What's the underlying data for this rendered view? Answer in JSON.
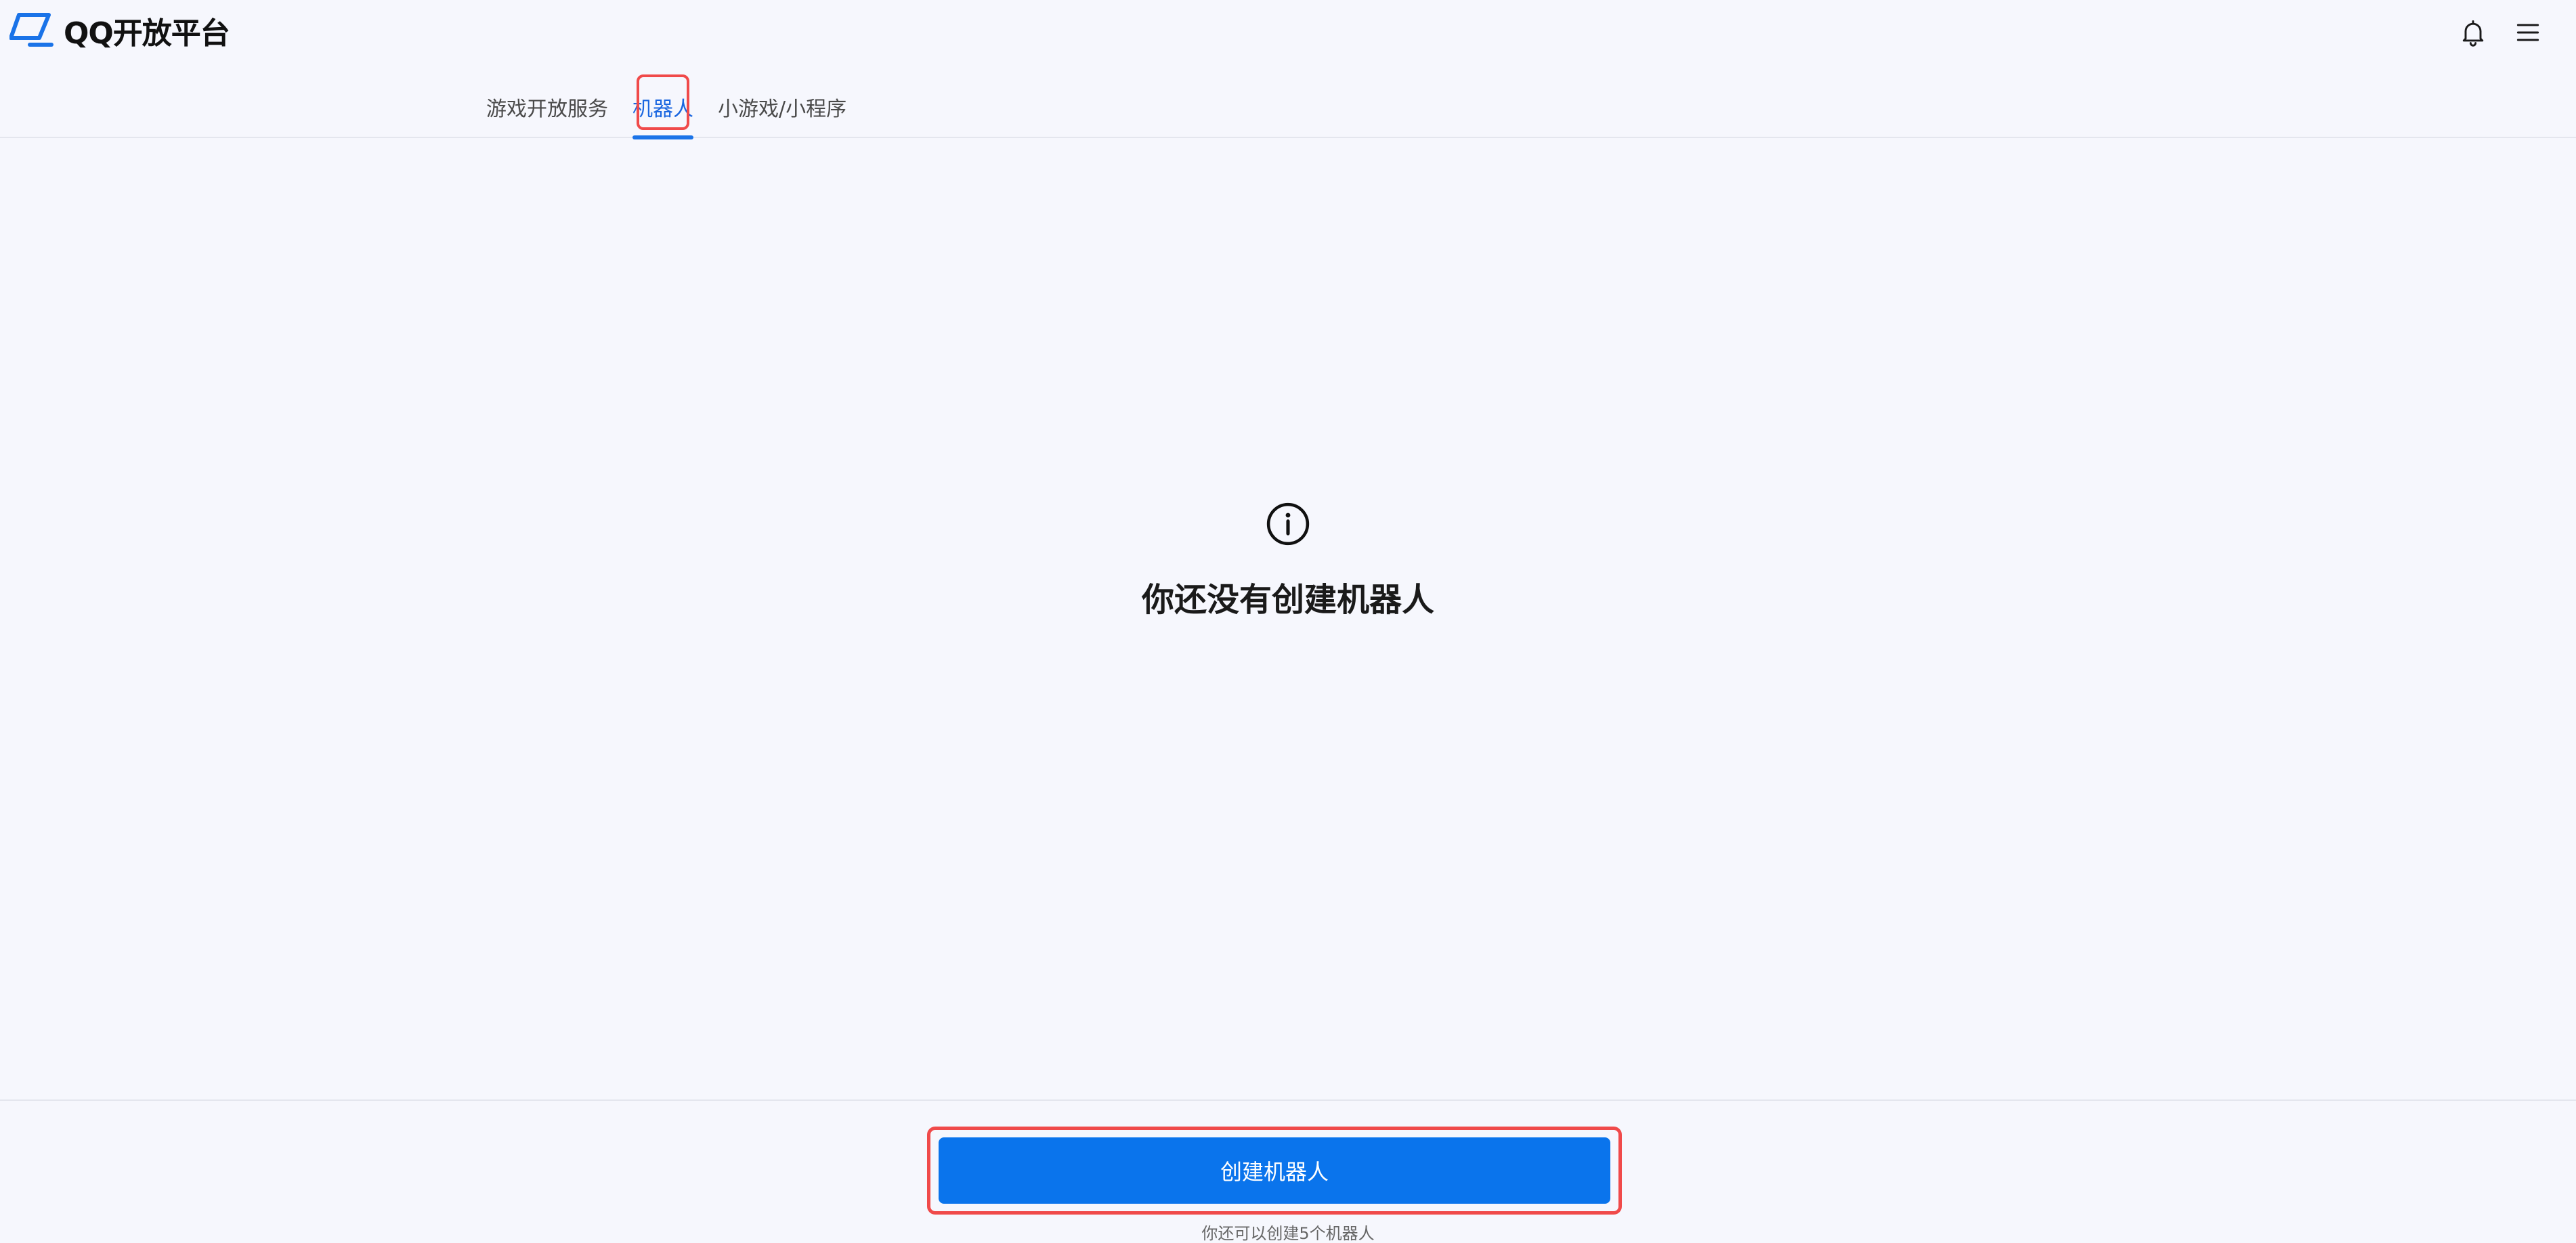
{
  "header": {
    "logo_text": "QQ开放平台",
    "logo_icon": "qq-logo-icon",
    "notification_icon": "bell-icon",
    "menu_icon": "hamburger-menu-icon"
  },
  "tabs": [
    {
      "label": "游戏开放服务",
      "active": false
    },
    {
      "label": "机器人",
      "active": true
    },
    {
      "label": "小游戏/小程序",
      "active": false
    }
  ],
  "empty_state": {
    "icon": "info-icon",
    "title": "你还没有创建机器人"
  },
  "footer": {
    "create_button_label": "创建机器人",
    "quota_note": "你还可以创建5个机器人"
  },
  "colors": {
    "accent": "#0a74ec",
    "active_tab": "#1a66e0",
    "highlight": "#f04a4a",
    "background": "#f6f7fd"
  }
}
